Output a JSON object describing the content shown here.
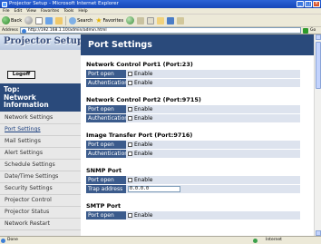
{
  "window": {
    "title": "Projector Setup - Microsoft Internet Explorer",
    "controls": [
      "_",
      "□",
      "×"
    ]
  },
  "menu": [
    "File",
    "Edit",
    "View",
    "Favorites",
    "Tools",
    "Help"
  ],
  "toolbar": {
    "back": "Back",
    "search": "Search",
    "favorites": "Favorites"
  },
  "address": {
    "label": "Address",
    "url": "http://192.168.1.10/admin/admin.html",
    "go": "Go"
  },
  "brand": "Projector Setup",
  "sidebar": {
    "logoff": "Logoff",
    "top_line1": "Top:",
    "top_line2": "Network",
    "top_line3": "Information",
    "items": [
      "Network Settings",
      "Port Settings",
      "Mail Settings",
      "Alert Settings",
      "Schedule Settings",
      "Date/Time Settings",
      "Security Settings",
      "Projector Control",
      "Projector Status",
      "Network Restart"
    ]
  },
  "main": {
    "header": "Port Settings",
    "sections": [
      {
        "title": "Network Control Port1 (Port:23)",
        "rows": [
          [
            "Port open",
            "Enable"
          ],
          [
            "Authentication",
            "Enable"
          ]
        ]
      },
      {
        "title": "Network Control Port2 (Port:9715)",
        "rows": [
          [
            "Port open",
            "Enable"
          ],
          [
            "Authentication",
            "Enable"
          ]
        ]
      },
      {
        "title": "Image Transfer Port (Port:9716)",
        "rows": [
          [
            "Port open",
            "Enable"
          ],
          [
            "Authentication",
            "Enable"
          ]
        ]
      },
      {
        "title": "SNMP Port",
        "rows": [
          [
            "Port open",
            "Enable"
          ],
          [
            "Trap address",
            "0.0.0.0"
          ]
        ]
      },
      {
        "title": "SMTP Port",
        "rows": [
          [
            "Port open",
            "Enable"
          ]
        ]
      }
    ]
  },
  "status": {
    "text": "Done",
    "zone": "Internet"
  },
  "colors": {
    "nav_dark": "#2a4a7b",
    "label_bg": "#3b5b8c",
    "value_bg": "#dde3ee"
  }
}
